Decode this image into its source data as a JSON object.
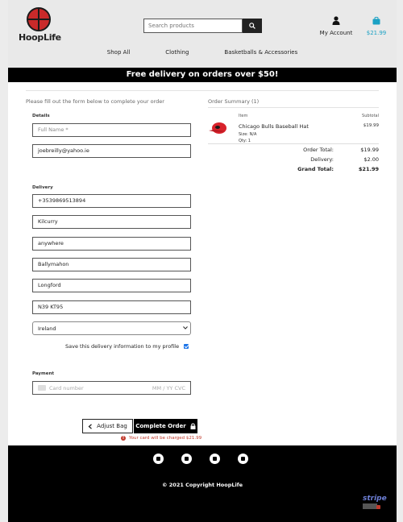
{
  "header": {
    "brand": "HoopLife",
    "search_placeholder": "Search products",
    "account_label": "My Account",
    "bag_total": "$21.99"
  },
  "nav": {
    "items": [
      "Shop All",
      "Clothing",
      "Basketballs & Accessories"
    ]
  },
  "banner": "Free delivery on orders over $50!",
  "form": {
    "intro": "Please fill out the form below to complete your order",
    "details_label": "Details",
    "full_name_placeholder": "Full Name *",
    "email": "joebreilly@yahoo.ie",
    "delivery_label": "Delivery",
    "phone": "+3539869513894",
    "street1": "Kilcurry",
    "street2": "anywhere",
    "town": "Ballymahon",
    "county": "Longford",
    "postcode": "N39 KT95",
    "country": "Ireland",
    "save_info_label": "Save this delivery information to my profile",
    "payment_label": "Payment",
    "card_placeholder": "Card number",
    "expiry_cvc_placeholder": "MM / YY  CVC",
    "adjust_bag_label": "Adjust Bag",
    "complete_order_label": "Complete Order",
    "charge_note": "Your card will be charged $21.99"
  },
  "summary": {
    "title": "Order Summary (1)",
    "col_item": "Item",
    "col_subtotal": "Subtotal",
    "product_name": "Chicago Bulls Baseball Hat",
    "size": "Size: N/A",
    "qty": "Qty: 1",
    "product_subtotal": "$19.99",
    "order_total_label": "Order Total:",
    "order_total": "$19.99",
    "delivery_label": "Delivery:",
    "delivery": "$2.00",
    "grand_total_label": "Grand Total:",
    "grand_total": "$21.99"
  },
  "footer": {
    "social_icons": [
      "facebook-icon",
      "instagram-icon",
      "twitter-icon",
      "youtube-icon"
    ],
    "copyright": "© 2021 Copyright HoopLife",
    "stripe_label": "stripe"
  },
  "colors": {
    "accent": "#1ba1c4",
    "warning": "#c0392b",
    "banner_bg": "#000000"
  }
}
